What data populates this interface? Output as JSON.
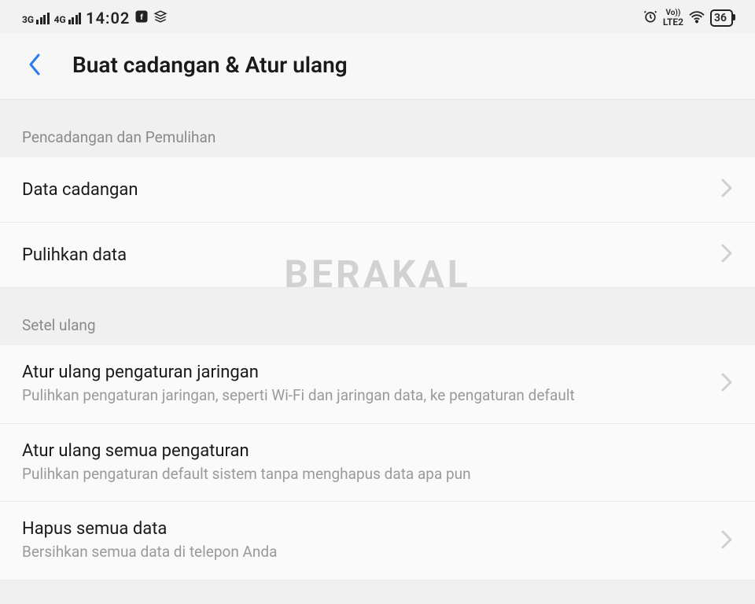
{
  "status_bar": {
    "sig1_label": "3G",
    "sig2_label": "4G",
    "time": "14:02",
    "lte_label": "LTE2",
    "volte_label": "Vo))",
    "battery_percent": "36"
  },
  "header": {
    "title": "Buat cadangan & Atur ulang"
  },
  "sections": [
    {
      "label": "Pencadangan dan Pemulihan",
      "items": [
        {
          "title": "Data cadangan",
          "subtitle": "",
          "chevron": true
        },
        {
          "title": "Pulihkan data",
          "subtitle": "",
          "chevron": true
        }
      ]
    },
    {
      "label": "Setel ulang",
      "items": [
        {
          "title": "Atur ulang pengaturan jaringan",
          "subtitle": "Pulihkan pengaturan jaringan, seperti Wi-Fi dan jaringan data, ke pengaturan default",
          "chevron": true
        },
        {
          "title": "Atur ulang semua pengaturan",
          "subtitle": "Pulihkan pengaturan default sistem tanpa menghapus data apa pun",
          "chevron": false
        },
        {
          "title": "Hapus semua data",
          "subtitle": "Bersihkan semua data di telepon Anda",
          "chevron": true
        }
      ]
    }
  ],
  "watermark": "BERAKAL"
}
